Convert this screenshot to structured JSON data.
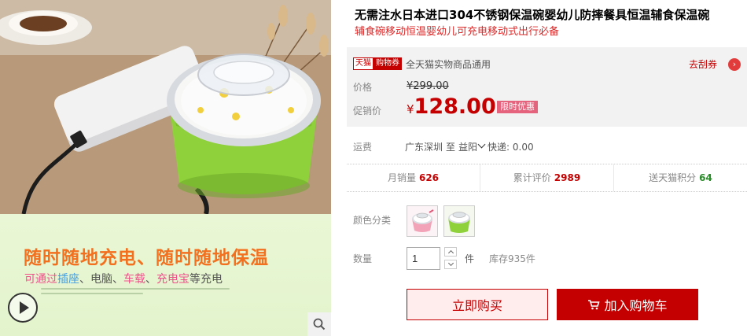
{
  "gallery": {
    "banner_title": "随时随地充电、随时随地保温",
    "banner_sub": {
      "prefix": "可通过",
      "item1": "插座",
      "sep1": "、",
      "item2": "电脑",
      "sep2": "、",
      "item3": "车载",
      "sep3": "、",
      "item4": "充电宝",
      "suffix": "等充电"
    },
    "play_icon": "play-icon",
    "zoom_icon": "magnifier-icon"
  },
  "product": {
    "title": "无需注水日本进口304不锈钢保温碗婴幼儿防摔餐具恒温辅食保温碗",
    "subtitle": "辅食碗移动恒温婴幼儿可充电移动式出行必备"
  },
  "price": {
    "tag_tmall": "天猫",
    "tag_coupon": "购物券",
    "coupon_text": "全天猫实物商品通用",
    "get_coupon": "去刮券",
    "get_coupon_icon": "›",
    "original_label": "价格",
    "original_value": "¥299.00",
    "sale_label": "促销价",
    "currency": "¥",
    "sale_value": "128.00",
    "promo": "限时优惠"
  },
  "shipping": {
    "label": "运费",
    "from": "广东深圳",
    "to_word": "至",
    "to": "益阳",
    "fee": "快递: 0.00"
  },
  "stats": [
    {
      "label": "月销量",
      "value": "626"
    },
    {
      "label": "累计评价",
      "value": "2989"
    },
    {
      "label": "送天猫积分",
      "value": "64"
    }
  ],
  "sku": {
    "label": "颜色分类",
    "options": [
      "pink",
      "green"
    ]
  },
  "quantity": {
    "label": "数量",
    "value": "1",
    "unit": "件",
    "stock": "库存935件"
  },
  "actions": {
    "buy_now": "立即购买",
    "add_cart": "加入购物车"
  },
  "colors": {
    "accent": "#c40000",
    "bowl_green": "#8ed13a",
    "banner_orange": "#f3701f"
  }
}
